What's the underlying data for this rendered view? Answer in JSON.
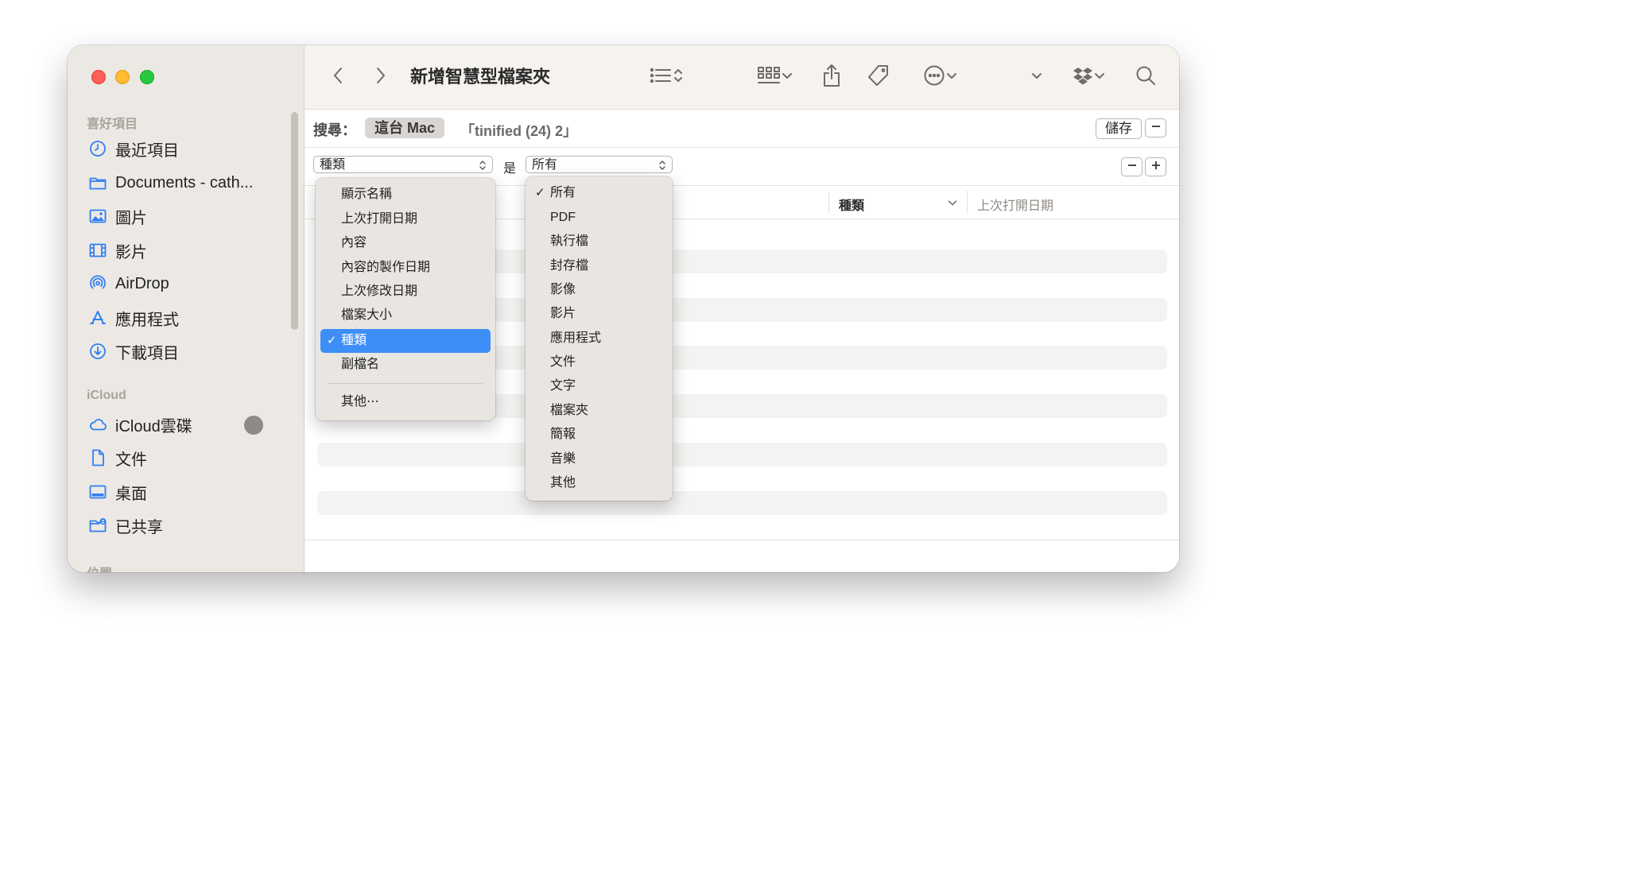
{
  "window": {
    "title": "新增智慧型檔案夾"
  },
  "sidebar": {
    "favorites_header": "喜好項目",
    "favorites": [
      {
        "label": "最近項目",
        "icon": "clock-icon"
      },
      {
        "label": "Documents - cath...",
        "icon": "folder-icon"
      },
      {
        "label": "圖片",
        "icon": "photo-icon"
      },
      {
        "label": "影片",
        "icon": "film-icon"
      },
      {
        "label": "AirDrop",
        "icon": "airdrop-icon"
      },
      {
        "label": "應用程式",
        "icon": "applications-icon"
      },
      {
        "label": "下載項目",
        "icon": "download-icon"
      }
    ],
    "icloud_header": "iCloud",
    "icloud": [
      {
        "label": "iCloud雲碟",
        "icon": "cloud-icon"
      },
      {
        "label": "文件",
        "icon": "document-icon"
      },
      {
        "label": "桌面",
        "icon": "desktop-icon"
      },
      {
        "label": "已共享",
        "icon": "shared-folder-icon"
      }
    ],
    "locations_header": "位置"
  },
  "search": {
    "label": "搜尋：",
    "scope_selected": "這台 Mac",
    "scope_other": "「tinified (24) 2」",
    "save_label": "儲存"
  },
  "criteria": {
    "attribute_value": "種類",
    "operator_label": "是",
    "value_value": "所有"
  },
  "columns": {
    "kind": "種類",
    "last_opened": "上次打開日期"
  },
  "attribute_menu": {
    "items": [
      "顯示名稱",
      "上次打開日期",
      "內容",
      "內容的製作日期",
      "上次修改日期",
      "檔案大小",
      "種類",
      "副檔名"
    ],
    "selected": "種類",
    "other": "其他⋯"
  },
  "kind_menu": {
    "items": [
      "所有",
      "PDF",
      "執行檔",
      "封存檔",
      "影像",
      "影片",
      "應用程式",
      "文件",
      "文字",
      "檔案夾",
      "簡報",
      "音樂",
      "其他"
    ],
    "checked": "所有"
  },
  "colors": {
    "accent": "#3d8ef7",
    "sidebar_icon": "#2f7ff2",
    "close": "#fe5f57",
    "minimize": "#febc2e",
    "zoom": "#28c840"
  }
}
